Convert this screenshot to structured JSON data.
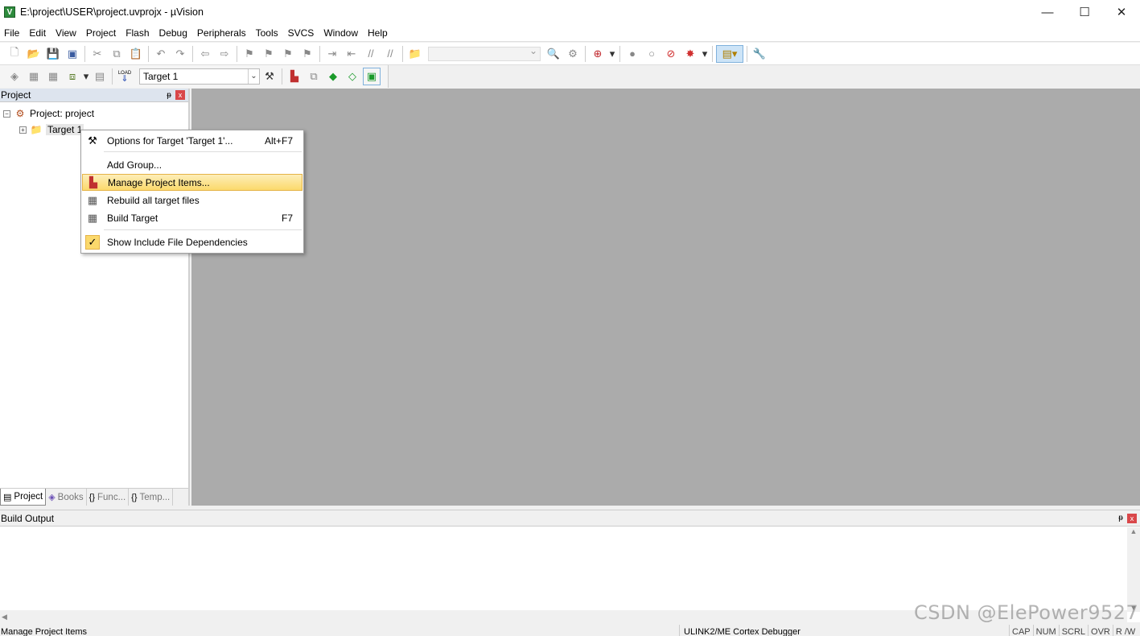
{
  "window": {
    "title": "E:\\project\\USER\\project.uvprojx - µVision",
    "app_icon_letter": "V",
    "minimize_glyph": "—",
    "maximize_glyph": "☐",
    "close_glyph": "✕"
  },
  "menubar": {
    "items": [
      "File",
      "Edit",
      "View",
      "Project",
      "Flash",
      "Debug",
      "Peripherals",
      "Tools",
      "SVCS",
      "Window",
      "Help"
    ]
  },
  "toolbar2": {
    "target_value": "Target 1",
    "load_label": "LOAD"
  },
  "project_panel": {
    "title": "Project",
    "pin_glyph": "ᵽ",
    "close_glyph": "x",
    "tree": {
      "root_label": "Project: project",
      "root_expander": "−",
      "target_label": "Target 1",
      "target_expander": "+"
    },
    "tabs": [
      {
        "label": "Project",
        "icon": "project-tab-icon",
        "glyph": "▤"
      },
      {
        "label": "Books",
        "icon": "books-tab-icon",
        "glyph": "◈"
      },
      {
        "label": "Func...",
        "icon": "functions-tab-icon",
        "glyph": "{}"
      },
      {
        "label": "Temp...",
        "icon": "templates-tab-icon",
        "glyph": "{}"
      }
    ]
  },
  "context_menu": {
    "items": [
      {
        "label": "Options for Target 'Target 1'...",
        "shortcut": "Alt+F7",
        "icon": "options-wand-icon"
      },
      {
        "label": "Add Group...",
        "shortcut": "",
        "icon": ""
      },
      {
        "label": "Manage Project Items...",
        "shortcut": "",
        "icon": "manage-items-icon",
        "highlighted": true
      },
      {
        "label": "Rebuild all target files",
        "shortcut": "",
        "icon": "rebuild-icon"
      },
      {
        "label": "Build Target",
        "shortcut": "F7",
        "icon": "build-icon"
      },
      {
        "label": "Show Include File Dependencies",
        "shortcut": "",
        "icon": "check-icon",
        "checked": true
      }
    ]
  },
  "build_output": {
    "title": "Build Output"
  },
  "statusbar": {
    "message": "Manage Project Items",
    "debugger": "ULINK2/ME Cortex Debugger",
    "keys": [
      "CAP",
      "NUM",
      "SCRL",
      "OVR",
      "R /W"
    ]
  },
  "watermark": "CSDN @ElePower9527",
  "colors": {
    "highlight_top": "#fdeeb9",
    "highlight_bottom": "#fbd96c",
    "editor_bg": "#ababab",
    "close_red": "#d9474a"
  }
}
